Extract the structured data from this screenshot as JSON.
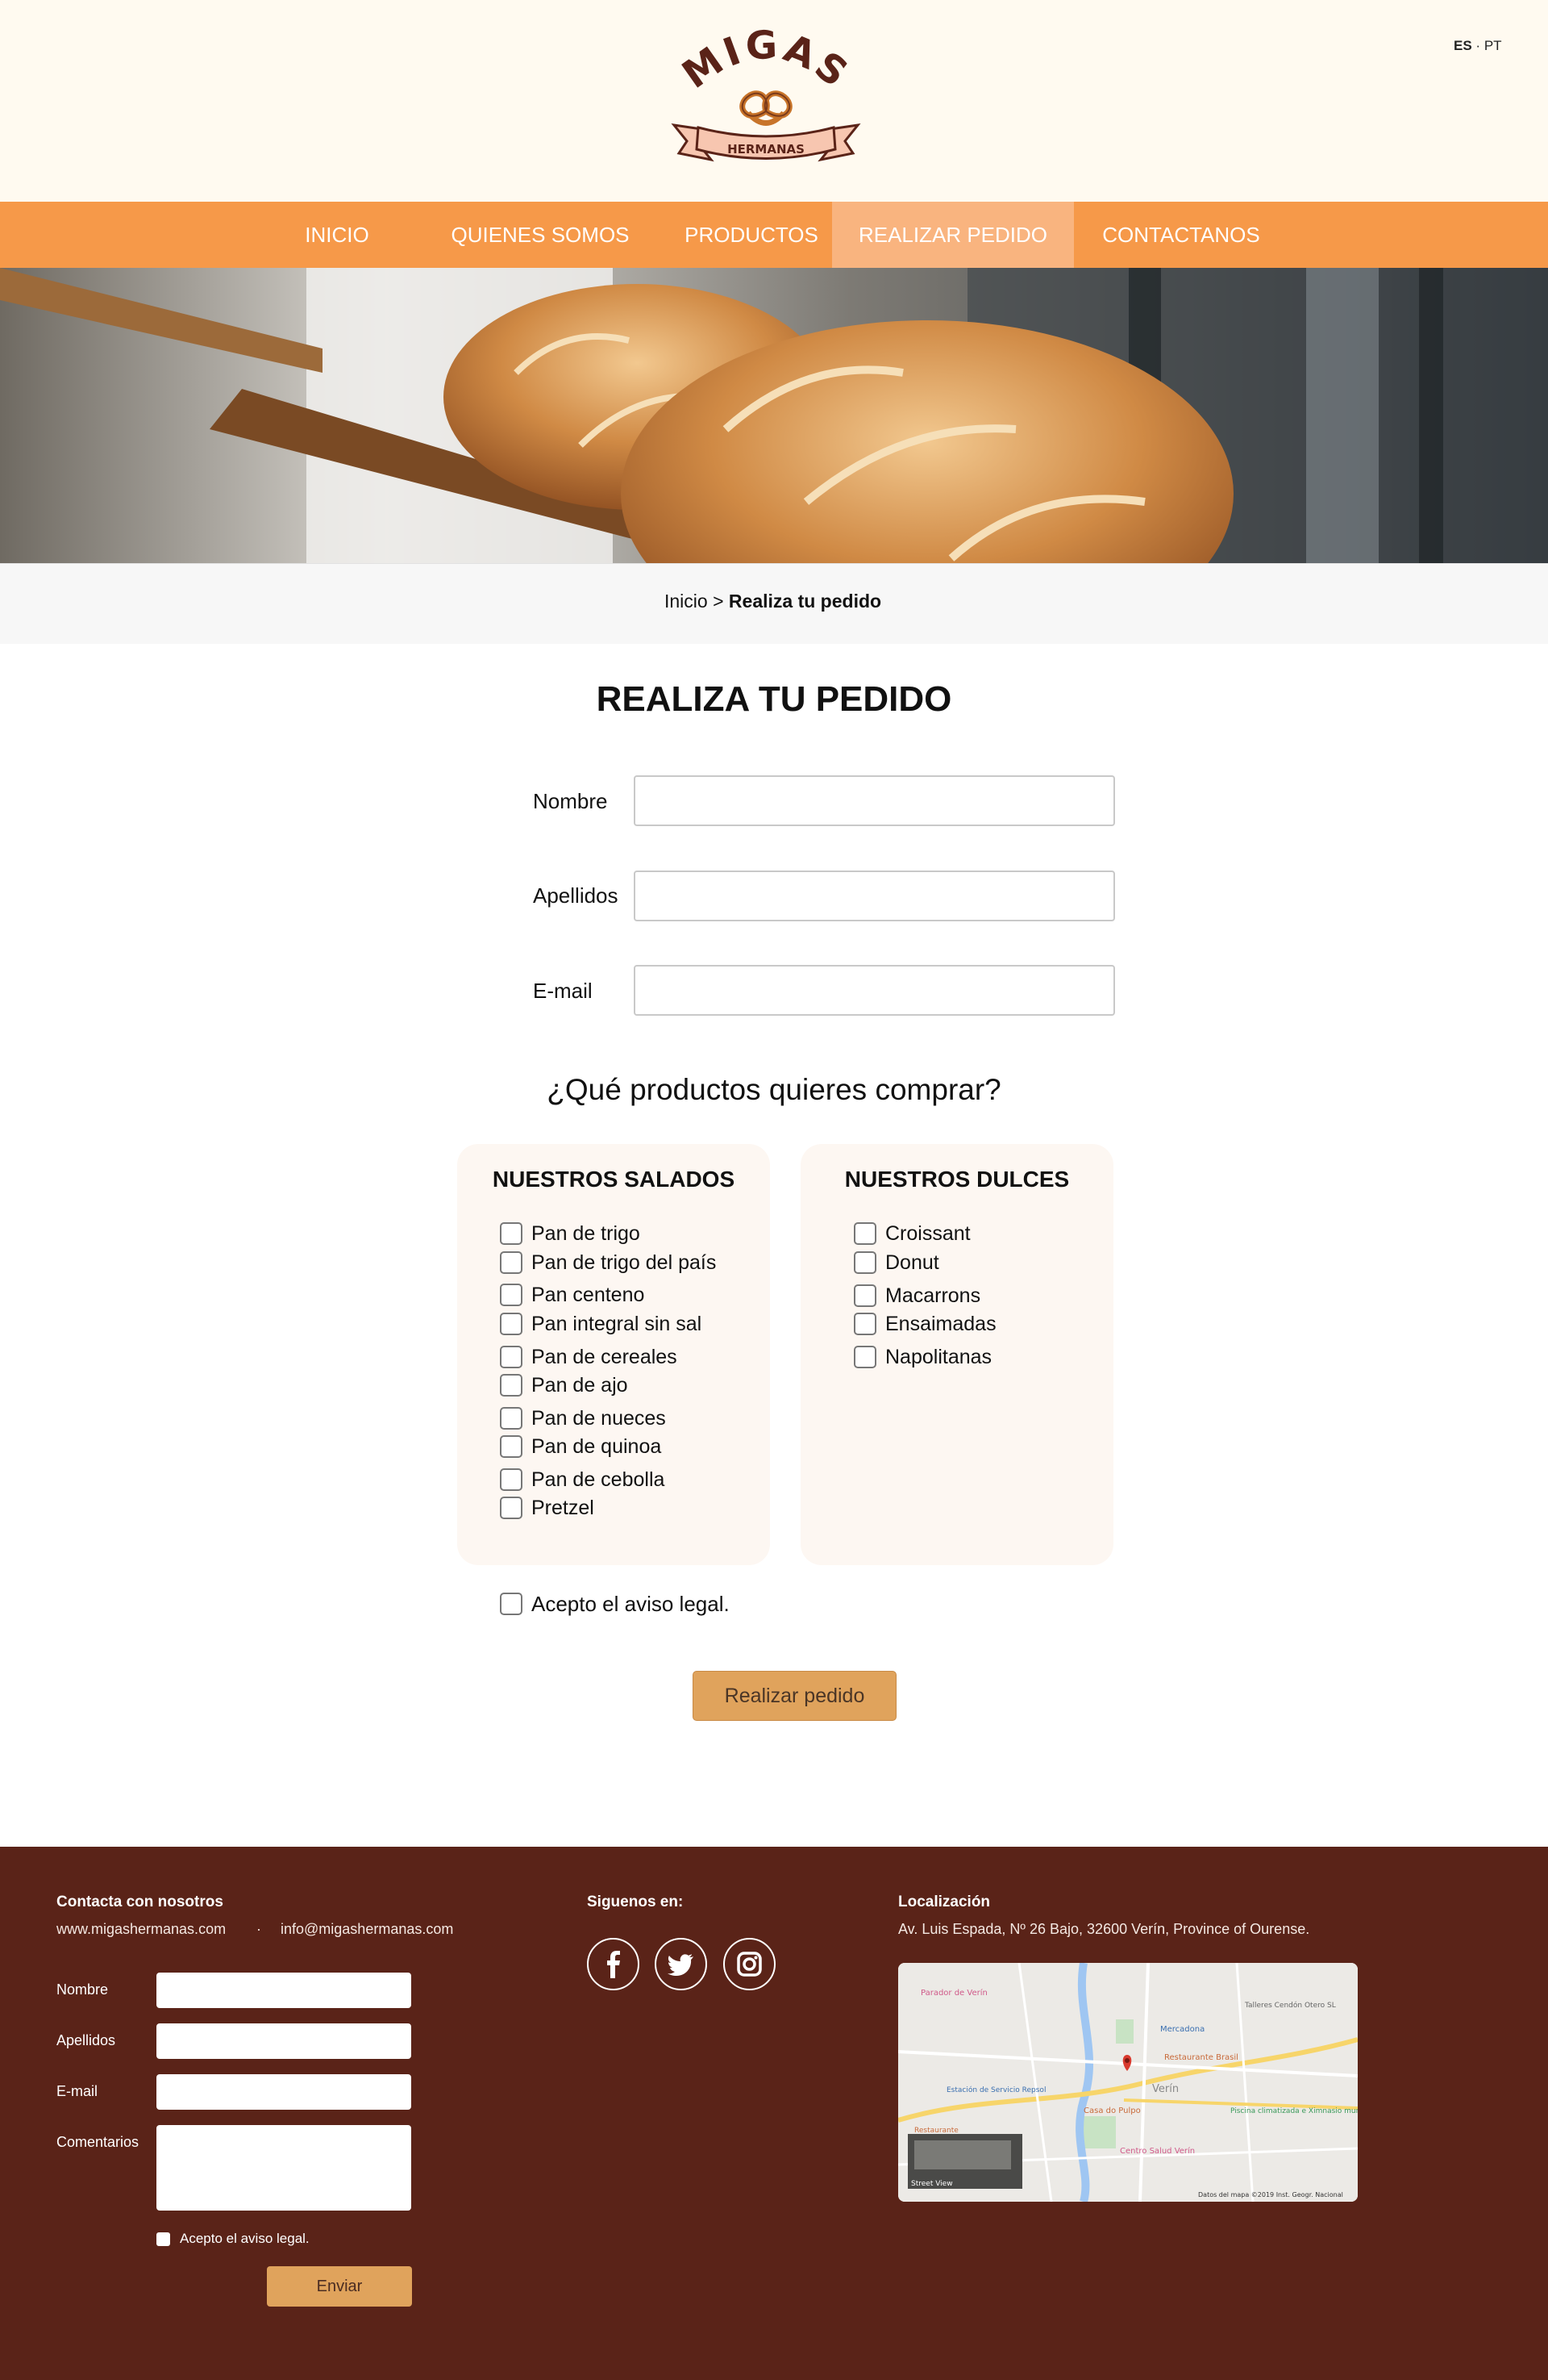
{
  "header": {
    "logo_text": "MIGAS",
    "logo_ribbon": "HERMANAS",
    "lang_es": "ES",
    "lang_sep": "·",
    "lang_pt": "PT"
  },
  "nav": [
    {
      "label": "INICIO"
    },
    {
      "label": "QUIENES SOMOS"
    },
    {
      "label": "PRODUCTOS"
    },
    {
      "label": "REALIZAR PEDIDO",
      "active": true
    },
    {
      "label": "CONTACTANOS"
    }
  ],
  "breadcrumb": {
    "home": "Inicio",
    "separator": ">",
    "current": "Realiza tu pedido"
  },
  "order_form": {
    "title": "REALIZA TU PEDIDO",
    "fields": [
      {
        "label": "Nombre",
        "value": ""
      },
      {
        "label": "Apellidos",
        "value": ""
      },
      {
        "label": "E-mail",
        "value": ""
      }
    ],
    "products_question": "¿Qué productos quieres comprar?",
    "salados": {
      "title": "NUESTROS SALADOS",
      "items": [
        "Pan de trigo",
        "Pan de trigo del país",
        "Pan centeno",
        "Pan integral sin sal",
        "Pan de cereales",
        "Pan de ajo",
        "Pan de nueces",
        "Pan de quinoa",
        "Pan de cebolla",
        "Pretzel"
      ]
    },
    "dulces": {
      "title": "NUESTROS DULCES",
      "items": [
        "Croissant",
        "Donut",
        "Macarrons",
        "Ensaimadas",
        "Napolitanas"
      ]
    },
    "legal": "Acepto el aviso legal.",
    "submit": "Realizar pedido"
  },
  "footer": {
    "contact_title": "Contacta con nosotros",
    "website": "www.migashermanas.com",
    "dot": "·",
    "email": "info@migashermanas.com",
    "form": {
      "fields": [
        "Nombre",
        "Apellidos",
        "E-mail",
        "Comentarios"
      ],
      "legal": "Acepto el aviso legal.",
      "submit": "Enviar"
    },
    "social_title": "Siguenos en:",
    "social": [
      "facebook-icon",
      "twitter-icon",
      "instagram-icon"
    ],
    "location_title": "Localización",
    "address": "Av. Luis Espada, Nº 26 Bajo, 32600 Verín, Province of Ourense.",
    "map": {
      "labels": [
        "Parador de Verín",
        "Talleres Cendón Otero SL",
        "Mercadona",
        "Restaurante Brasil",
        "Verín",
        "Estación de Servicio Repsol",
        "Casa do Pulpo",
        "Piscina climatizada e Ximnasio municipal",
        "Restaurante",
        "Centro Salud Verín",
        "Street View",
        "Datos del mapa ©2019 Inst. Geogr. Nacional"
      ]
    }
  },
  "colors": {
    "nav": "#f69949",
    "nav_active": "#f9b47f",
    "header_bg": "#fffaf0",
    "button": "#e0a35c",
    "footer": "#5a2318",
    "panel": "#fdf7f2"
  }
}
